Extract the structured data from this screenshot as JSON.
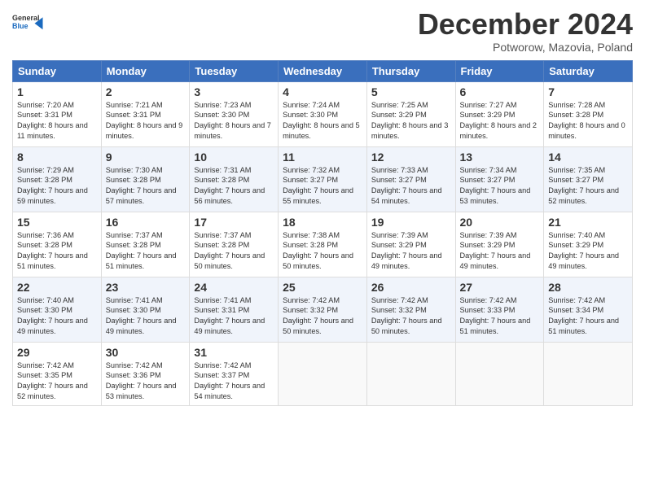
{
  "logo": {
    "general": "General",
    "blue": "Blue"
  },
  "header": {
    "month": "December 2024",
    "location": "Potworow, Mazovia, Poland"
  },
  "weekdays": [
    "Sunday",
    "Monday",
    "Tuesday",
    "Wednesday",
    "Thursday",
    "Friday",
    "Saturday"
  ],
  "weeks": [
    [
      {
        "day": "1",
        "sun": "7:20 AM",
        "set": "3:31 PM",
        "daylight": "8 hours and 11 minutes."
      },
      {
        "day": "2",
        "sun": "7:21 AM",
        "set": "3:31 PM",
        "daylight": "8 hours and 9 minutes."
      },
      {
        "day": "3",
        "sun": "7:23 AM",
        "set": "3:30 PM",
        "daylight": "8 hours and 7 minutes."
      },
      {
        "day": "4",
        "sun": "7:24 AM",
        "set": "3:30 PM",
        "daylight": "8 hours and 5 minutes."
      },
      {
        "day": "5",
        "sun": "7:25 AM",
        "set": "3:29 PM",
        "daylight": "8 hours and 3 minutes."
      },
      {
        "day": "6",
        "sun": "7:27 AM",
        "set": "3:29 PM",
        "daylight": "8 hours and 2 minutes."
      },
      {
        "day": "7",
        "sun": "7:28 AM",
        "set": "3:28 PM",
        "daylight": "8 hours and 0 minutes."
      }
    ],
    [
      {
        "day": "8",
        "sun": "7:29 AM",
        "set": "3:28 PM",
        "daylight": "7 hours and 59 minutes."
      },
      {
        "day": "9",
        "sun": "7:30 AM",
        "set": "3:28 PM",
        "daylight": "7 hours and 57 minutes."
      },
      {
        "day": "10",
        "sun": "7:31 AM",
        "set": "3:28 PM",
        "daylight": "7 hours and 56 minutes."
      },
      {
        "day": "11",
        "sun": "7:32 AM",
        "set": "3:27 PM",
        "daylight": "7 hours and 55 minutes."
      },
      {
        "day": "12",
        "sun": "7:33 AM",
        "set": "3:27 PM",
        "daylight": "7 hours and 54 minutes."
      },
      {
        "day": "13",
        "sun": "7:34 AM",
        "set": "3:27 PM",
        "daylight": "7 hours and 53 minutes."
      },
      {
        "day": "14",
        "sun": "7:35 AM",
        "set": "3:27 PM",
        "daylight": "7 hours and 52 minutes."
      }
    ],
    [
      {
        "day": "15",
        "sun": "7:36 AM",
        "set": "3:28 PM",
        "daylight": "7 hours and 51 minutes."
      },
      {
        "day": "16",
        "sun": "7:37 AM",
        "set": "3:28 PM",
        "daylight": "7 hours and 51 minutes."
      },
      {
        "day": "17",
        "sun": "7:37 AM",
        "set": "3:28 PM",
        "daylight": "7 hours and 50 minutes."
      },
      {
        "day": "18",
        "sun": "7:38 AM",
        "set": "3:28 PM",
        "daylight": "7 hours and 50 minutes."
      },
      {
        "day": "19",
        "sun": "7:39 AM",
        "set": "3:29 PM",
        "daylight": "7 hours and 49 minutes."
      },
      {
        "day": "20",
        "sun": "7:39 AM",
        "set": "3:29 PM",
        "daylight": "7 hours and 49 minutes."
      },
      {
        "day": "21",
        "sun": "7:40 AM",
        "set": "3:29 PM",
        "daylight": "7 hours and 49 minutes."
      }
    ],
    [
      {
        "day": "22",
        "sun": "7:40 AM",
        "set": "3:30 PM",
        "daylight": "7 hours and 49 minutes."
      },
      {
        "day": "23",
        "sun": "7:41 AM",
        "set": "3:30 PM",
        "daylight": "7 hours and 49 minutes."
      },
      {
        "day": "24",
        "sun": "7:41 AM",
        "set": "3:31 PM",
        "daylight": "7 hours and 49 minutes."
      },
      {
        "day": "25",
        "sun": "7:42 AM",
        "set": "3:32 PM",
        "daylight": "7 hours and 50 minutes."
      },
      {
        "day": "26",
        "sun": "7:42 AM",
        "set": "3:32 PM",
        "daylight": "7 hours and 50 minutes."
      },
      {
        "day": "27",
        "sun": "7:42 AM",
        "set": "3:33 PM",
        "daylight": "7 hours and 51 minutes."
      },
      {
        "day": "28",
        "sun": "7:42 AM",
        "set": "3:34 PM",
        "daylight": "7 hours and 51 minutes."
      }
    ],
    [
      {
        "day": "29",
        "sun": "7:42 AM",
        "set": "3:35 PM",
        "daylight": "7 hours and 52 minutes."
      },
      {
        "day": "30",
        "sun": "7:42 AM",
        "set": "3:36 PM",
        "daylight": "7 hours and 53 minutes."
      },
      {
        "day": "31",
        "sun": "7:42 AM",
        "set": "3:37 PM",
        "daylight": "7 hours and 54 minutes."
      },
      null,
      null,
      null,
      null
    ]
  ]
}
